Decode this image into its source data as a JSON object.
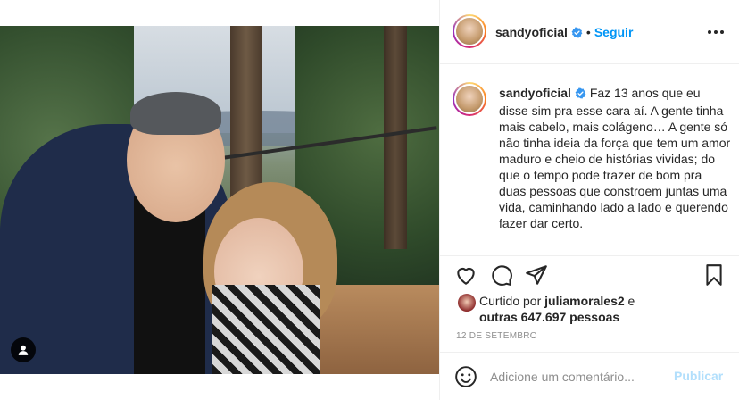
{
  "post": {
    "username": "sandyoficial",
    "separator": "•",
    "follow_label": "Seguir",
    "caption": "Faz 13 anos que eu disse sim pra esse cara aí. A gente tinha mais cabelo, mais colágeno… A gente só não tinha ideia da força que tem um amor maduro e cheio de histórias vividas; do que o tempo pode trazer de bom pra duas pessoas que constroem juntas uma vida, caminhando lado a lado e querendo fazer dar certo.",
    "liked_prefix": "Curtido por",
    "liked_by": "juliamorales2",
    "liked_and": "e",
    "others": "outras 647.697 pessoas",
    "date": "12 DE SETEMBRO"
  },
  "comment": {
    "placeholder": "Adicione um comentário...",
    "publish_label": "Publicar"
  },
  "icons": {
    "verified": "verified-badge-icon",
    "more": "more-options-icon",
    "like": "heart-icon",
    "comment": "comment-icon",
    "share": "paper-plane-icon",
    "save": "bookmark-icon",
    "emoji": "smiley-icon",
    "tag": "user-tag-icon"
  },
  "colors": {
    "accent": "#0095f6",
    "publish_disabled": "#b2dffc",
    "muted": "#8e8e8e",
    "text": "#262626"
  }
}
